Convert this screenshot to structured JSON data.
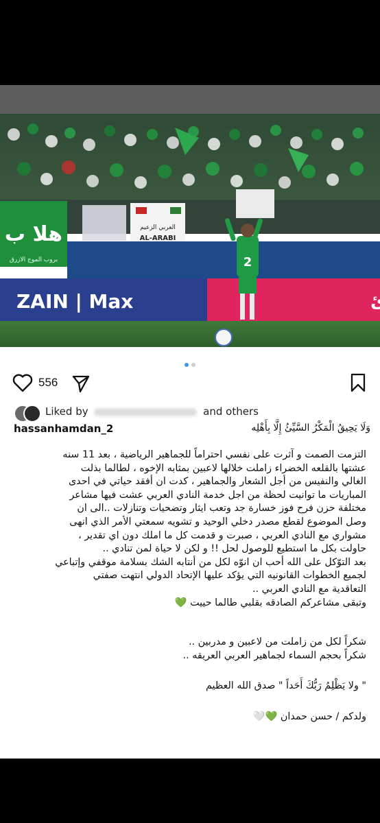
{
  "post": {
    "banner_left_text": "هلا ب",
    "banner_left_sub": "بروب الموج الازرق",
    "banner_mid_text": "العربي الزعيم",
    "banner_mid_sub": "AL-ARABI",
    "ad_left": "ZAIN | Max",
    "ad_right": "رفيه لكل العائ",
    "player_number": "2"
  },
  "actions": {
    "likes_count": "556"
  },
  "likes_line": {
    "prefix": "Liked by",
    "suffix": "and others"
  },
  "caption": {
    "username": "hassanhamdan_2",
    "verse": "وَلَا يَحِيقُ الْمَكْرُ السَّيِّئُ إِلَّا بِأَهْلِه",
    "lines": [
      "التزمت الصمت و آثرت على نفسي  احتراماً للجماهير الرياضية ، بعد 11 سنه",
      "عشتها بالقلعه الخضراء زاملت خلالها لاعبين بمثابه الإخوه ، لطالما بذلت",
      "الغالي والنفيس من أجل الشعار والجماهير ، كدت ان أفقد حياتي في احدى",
      "المباريات ما توانيت لحظة من اجل خدمة النادي العربي عشت فيها مشاعر",
      "مختلفة حزن فرح فوز خسارة جد وتعب ايثار وتضحيات وتنازلات ..الى ان",
      "وصل الموضوع لقطع مصدر دخلي الوحيد و تشويه سمعتي الأمر الذي انهى",
      "مشواري مع النادي العربي ، صبرت و قدمت كل ما املك دون اي تقدير ،",
      "حاولت بكل ما استطيع للوصول لحل !! و لكن لا حياة لمن تنادي ..",
      "بعد التوّكل على الله أحب ان انوّه لكل من أنتابه الشك بسلامة موقفي وإتباعي",
      "لجميع الخطوات القانونيه التي يؤكد عليها الإتحاد الدولي انتهت صفتي",
      "التعاقدية مع النادي العربي ..",
      "وتبقى مشاعركم الصادقه بقلبي طالما حييت"
    ],
    "thanks_lines": [
      "شكراً لكل من زاملت من لاعبين و مدربين ..",
      "شكراً بحجم السماء لجماهير العربي العريقه .."
    ],
    "quote": "\" ولا يَظْلِمُ رَبُّكَ أَحَداً \" صدق الله العظيم",
    "signature": "ولدكم / حسن حمدان"
  }
}
